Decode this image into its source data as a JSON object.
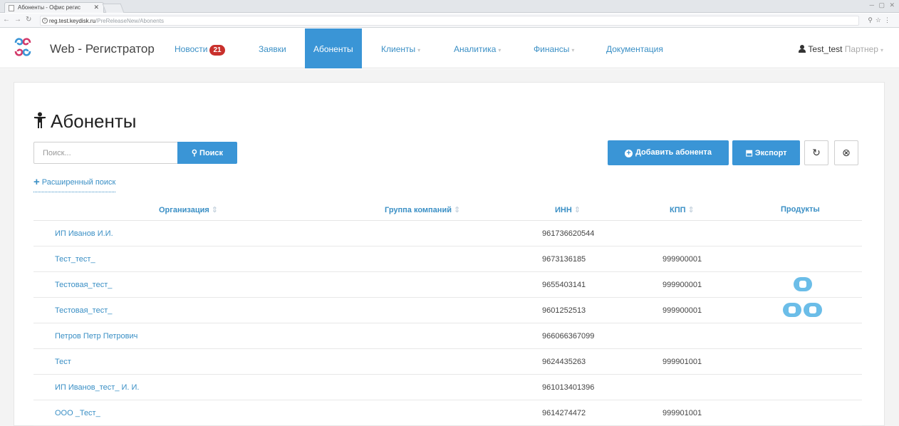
{
  "browser": {
    "tab_title": "Абоненты - Офис регис",
    "tab_close": "✕",
    "url_host": "reg.test.keydisk.ru",
    "url_path": "/PreReleaseNew/Abonents"
  },
  "navbar": {
    "brand": "Web - Регистратор",
    "items": [
      {
        "label": "Новости",
        "badge": "21"
      },
      {
        "label": "Заявки"
      },
      {
        "label": "Абоненты"
      },
      {
        "label": "Клиенты"
      },
      {
        "label": "Аналитика"
      },
      {
        "label": "Финансы"
      },
      {
        "label": "Документация"
      }
    ],
    "user_name": "Test_test",
    "user_role": "Партнер"
  },
  "page": {
    "title": "Абоненты",
    "search_placeholder": "Поиск...",
    "search_button": "Поиск",
    "advanced_search": "Расширенный поиск",
    "add_button": "Добавить абонента",
    "export_button": "Экспорт"
  },
  "table": {
    "columns": [
      "Организация",
      "Группа компаний",
      "ИНН",
      "КПП",
      "Продукты"
    ],
    "sort_glyph": "⇕",
    "rows": [
      {
        "org": "ИП Иванов И.И.",
        "inn": "961736620544",
        "kpp": "",
        "products": 0
      },
      {
        "org": "Тест_тест_",
        "inn": "9673136185",
        "kpp": "999900001",
        "products": 0
      },
      {
        "org": "Тестовая_тест_",
        "inn": "9655403141",
        "kpp": "999900001",
        "products": 1
      },
      {
        "org": "Тестовая_тест_",
        "inn": "9601252513",
        "kpp": "999900001",
        "products": 2
      },
      {
        "org": "Петров Петр Петрович",
        "inn": "966066367099",
        "kpp": "",
        "products": 0
      },
      {
        "org": "Тест",
        "inn": "9624435263",
        "kpp": "999901001",
        "products": 0
      },
      {
        "org": "ИП Иванов_тест_ И. И.",
        "inn": "961013401396",
        "kpp": "",
        "products": 0
      },
      {
        "org": "ООО _Тест_",
        "inn": "9614274472",
        "kpp": "999901001",
        "products": 0
      }
    ]
  },
  "colors": {
    "accent": "#3a95d6",
    "link": "#3a8fc5",
    "badge": "#c9302c",
    "product_pill": "#6bbde8"
  }
}
